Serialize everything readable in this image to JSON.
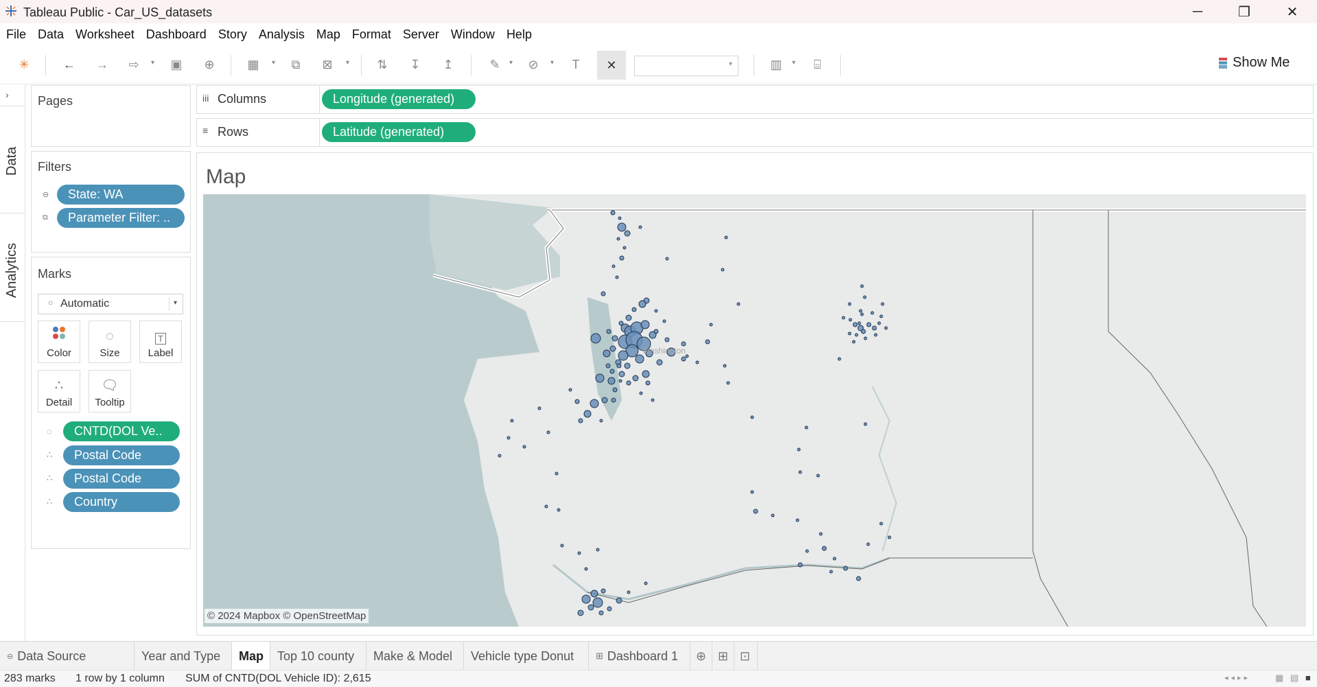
{
  "window": {
    "title": "Tableau Public - Car_US_datasets"
  },
  "menu": [
    "File",
    "Data",
    "Worksheet",
    "Dashboard",
    "Story",
    "Analysis",
    "Map",
    "Format",
    "Server",
    "Window",
    "Help"
  ],
  "toolbar": {
    "show_me_label": "Show Me"
  },
  "rail": {
    "data_tab": "Data",
    "analytics_tab": "Analytics"
  },
  "pages": {
    "title": "Pages"
  },
  "filters": {
    "title": "Filters",
    "items": [
      "State: WA",
      "Parameter Filter: .."
    ]
  },
  "marks": {
    "title": "Marks",
    "type_value": "Automatic",
    "cards": [
      "Color",
      "Size",
      "Label",
      "Detail",
      "Tooltip"
    ],
    "fields": [
      "CNTD(DOL Ve..",
      "Postal Code",
      "Postal Code",
      "Country"
    ]
  },
  "shelves": {
    "columns_label": "Columns",
    "columns_pill": "Longitude (generated)",
    "rows_label": "Rows",
    "rows_pill": "Latitude (generated)"
  },
  "view": {
    "title": "Map",
    "map_label": "Washington",
    "attribution": "© 2024 Mapbox © OpenStreetMap"
  },
  "tabs": {
    "data_source": "Data Source",
    "sheets": [
      "Year and Type",
      "Map",
      "Top 10 county",
      "Make & Model",
      "Vehicle type Donut"
    ],
    "active": "Map",
    "dashboard": "Dashboard 1"
  },
  "status": {
    "marks": "283 marks",
    "rows_cols": "1 row by 1 column",
    "sum": "SUM of CNTD(DOL Vehicle ID): 2,615"
  },
  "colors": {
    "green_pill": "#1fae7a",
    "blue_pill": "#4b92b8",
    "mark_fill": "#6a8fb8",
    "water": "#b9cbcd",
    "land": "#e9eaea"
  }
}
